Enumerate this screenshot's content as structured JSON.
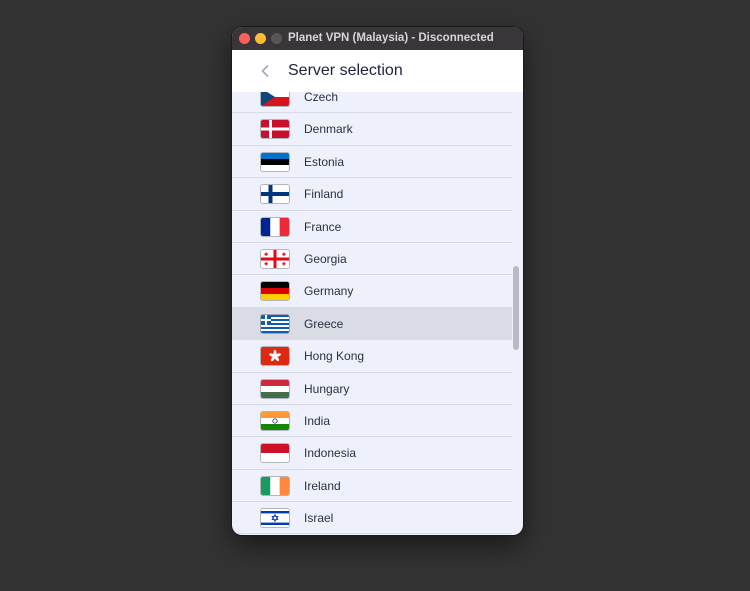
{
  "window": {
    "title": "Planet VPN (Malaysia) - Disconnected"
  },
  "header": {
    "title": "Server selection"
  },
  "colors": {
    "background": "#333333",
    "titlebar": "#3a3539",
    "list_background": "#eef1fb",
    "selected_row": "#d9dce4",
    "close": "#fe5f57",
    "minimize": "#febc2e"
  },
  "countries": [
    {
      "name": "Czech",
      "flag": "czech-flag"
    },
    {
      "name": "Denmark",
      "flag": "denmark-flag"
    },
    {
      "name": "Estonia",
      "flag": "estonia-flag"
    },
    {
      "name": "Finland",
      "flag": "finland-flag"
    },
    {
      "name": "France",
      "flag": "france-flag"
    },
    {
      "name": "Georgia",
      "flag": "georgia-flag"
    },
    {
      "name": "Germany",
      "flag": "germany-flag"
    },
    {
      "name": "Greece",
      "flag": "greece-flag",
      "selected": true
    },
    {
      "name": "Hong Kong",
      "flag": "hong-kong-flag"
    },
    {
      "name": "Hungary",
      "flag": "hungary-flag"
    },
    {
      "name": "India",
      "flag": "india-flag"
    },
    {
      "name": "Indonesia",
      "flag": "indonesia-flag"
    },
    {
      "name": "Ireland",
      "flag": "ireland-flag"
    },
    {
      "name": "Israel",
      "flag": "israel-flag"
    }
  ]
}
